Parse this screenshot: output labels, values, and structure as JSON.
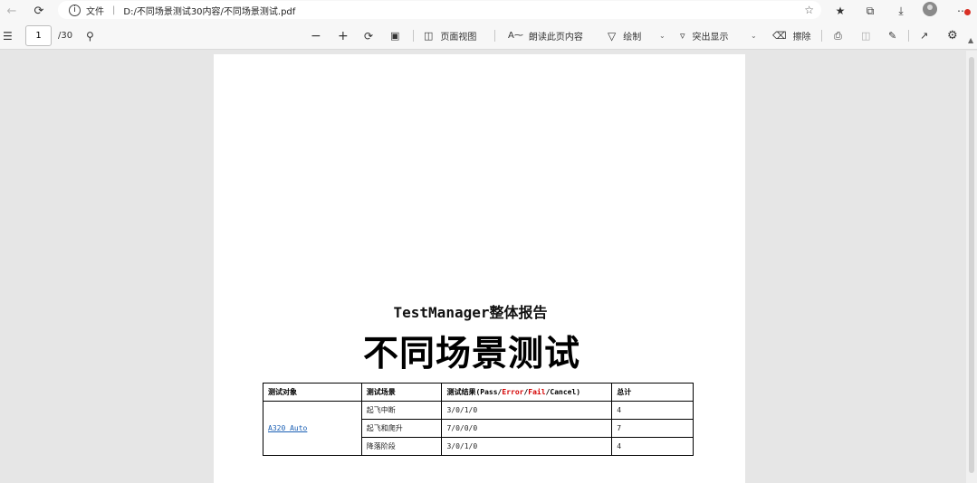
{
  "browser": {
    "file_label": "文件",
    "url": "D:/不同场景测试30内容/不同场景测试.pdf",
    "icons": [
      "back-icon",
      "refresh-icon",
      "info-icon",
      "favorite-add-icon",
      "favorites-icon",
      "collections-icon",
      "downloads-icon",
      "profile-icon",
      "more-icon"
    ]
  },
  "toolbar": {
    "page_current": "1",
    "page_total": "/30",
    "page_view": "页面视图",
    "read_aloud": "朗读此页内容",
    "draw": "绘制",
    "highlight": "突出显示",
    "erase": "擦除"
  },
  "document": {
    "report_title": "TestManager整体报告",
    "doc_title": "不同场景测试",
    "table": {
      "headers": {
        "object": "测试对象",
        "scene": "测试场景",
        "result_prefix": "测试结果(Pass/",
        "result_error": "Error",
        "result_slash1": "/",
        "result_fail": "Fail",
        "result_suffix": "/Cancel)",
        "total": "总计"
      },
      "object": "A320 Auto",
      "rows": [
        {
          "scene": "起飞中断",
          "result": "3/0/1/0",
          "total": "4"
        },
        {
          "scene": "起飞和爬升",
          "result": "7/0/0/0",
          "total": "7"
        },
        {
          "scene": "降落阶段",
          "result": "3/0/1/0",
          "total": "4"
        }
      ]
    }
  },
  "colors": {
    "error_fail_red": "#d40000",
    "link_blue": "#1a5fb4",
    "viewer_background": "#e6e6e6"
  }
}
